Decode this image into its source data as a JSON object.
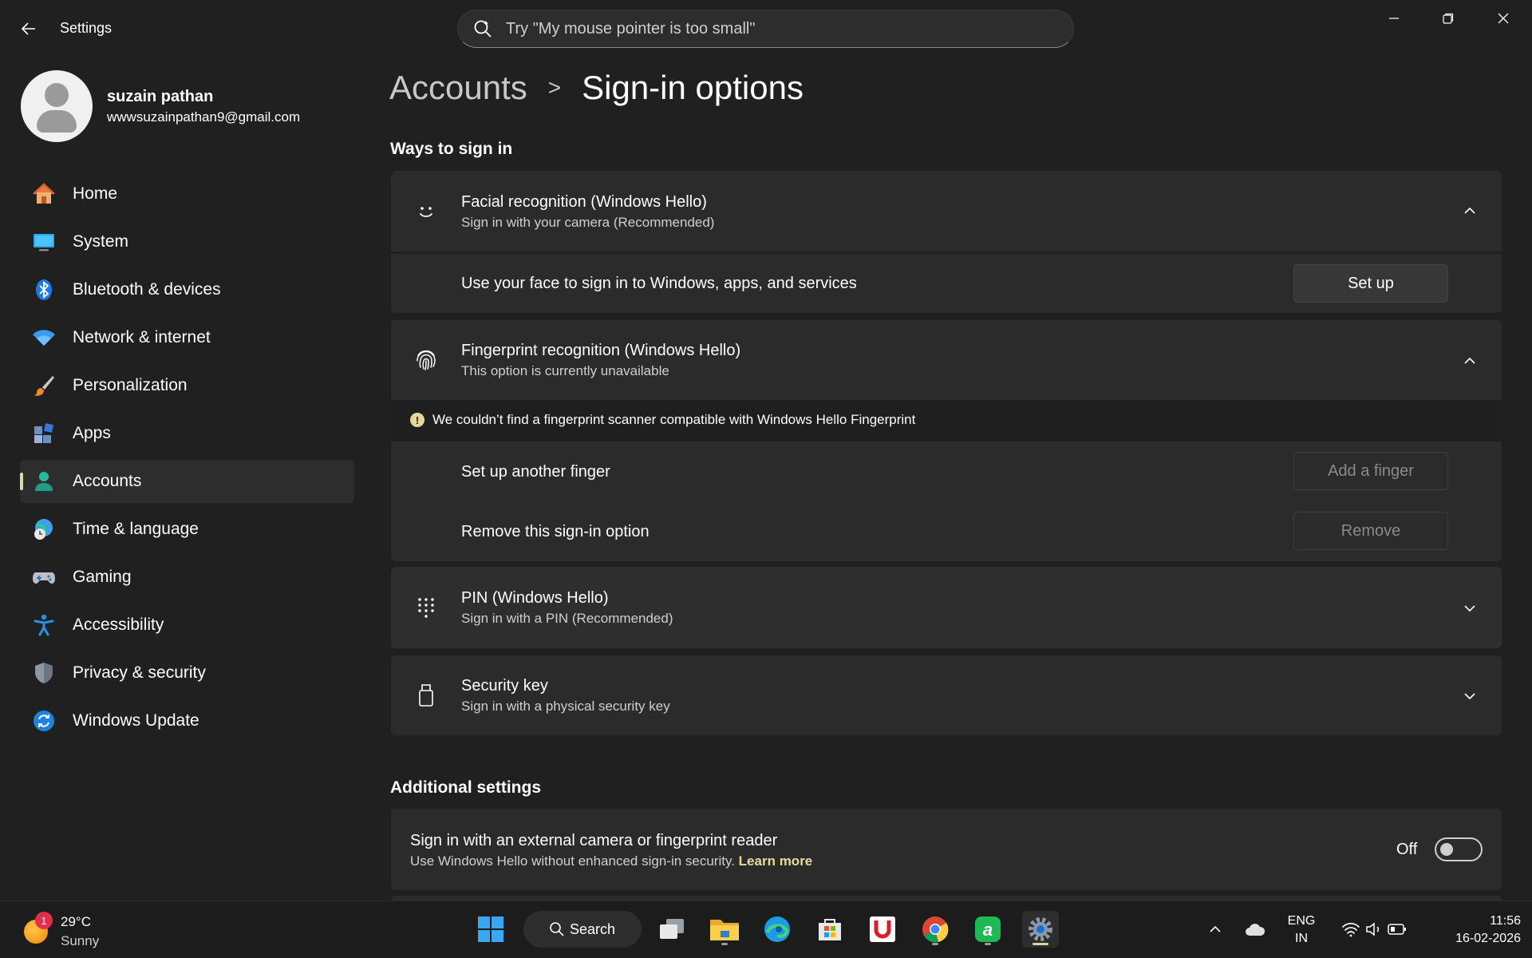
{
  "app": {
    "title": "Settings"
  },
  "search": {
    "placeholder": "Try \"My mouse pointer is too small\""
  },
  "profile": {
    "name": "suzain pathan",
    "email": "wwwsuzainpathan9@gmail.com"
  },
  "nav": [
    {
      "label": "Home",
      "icon": "home-icon",
      "active": false
    },
    {
      "label": "System",
      "icon": "system-icon",
      "active": false
    },
    {
      "label": "Bluetooth & devices",
      "icon": "bluetooth-icon",
      "active": false
    },
    {
      "label": "Network & internet",
      "icon": "wifi-icon",
      "active": false
    },
    {
      "label": "Personalization",
      "icon": "brush-icon",
      "active": false
    },
    {
      "label": "Apps",
      "icon": "apps-icon",
      "active": false
    },
    {
      "label": "Accounts",
      "icon": "accounts-icon",
      "active": true
    },
    {
      "label": "Time & language",
      "icon": "globe-clock-icon",
      "active": false
    },
    {
      "label": "Gaming",
      "icon": "gamepad-icon",
      "active": false
    },
    {
      "label": "Accessibility",
      "icon": "accessibility-icon",
      "active": false
    },
    {
      "label": "Privacy & security",
      "icon": "shield-icon",
      "active": false
    },
    {
      "label": "Windows Update",
      "icon": "update-icon",
      "active": false
    }
  ],
  "breadcrumb": {
    "parent": "Accounts",
    "separator": ">",
    "current": "Sign-in options"
  },
  "ways": {
    "title": "Ways to sign in",
    "facial": {
      "title": "Facial recognition (Windows Hello)",
      "subtitle": "Sign in with your camera (Recommended)",
      "row_label": "Use your face to sign in to Windows, apps, and services",
      "button": "Set up"
    },
    "fingerprint": {
      "title": "Fingerprint recognition (Windows Hello)",
      "subtitle": "This option is currently unavailable",
      "warning": "We couldn’t find a fingerprint scanner compatible with Windows Hello Fingerprint",
      "warning_symbol": "!",
      "row1_label": "Set up another finger",
      "row1_button": "Add a finger",
      "row2_label": "Remove this sign-in option",
      "row2_button": "Remove"
    },
    "pin": {
      "title": "PIN (Windows Hello)",
      "subtitle": "Sign in with a PIN (Recommended)"
    },
    "security_key": {
      "title": "Security key",
      "subtitle": "Sign in with a physical security key"
    }
  },
  "additional": {
    "title": "Additional settings",
    "external": {
      "title": "Sign in with an external camera or fingerprint reader",
      "subtitle": "Use Windows Hello without enhanced sign-in security.",
      "link": "Learn more",
      "toggle_state": "Off"
    }
  },
  "taskbar": {
    "weather_temp": "29°C",
    "weather_cond": "Sunny",
    "weather_badge": "1",
    "search_label": "Search",
    "lang_top": "ENG",
    "lang_bottom": "IN",
    "time": "11:56",
    "date": "16-02-2026"
  },
  "colors": {
    "accent": "#d9d7a6",
    "link": "#e8dc9a",
    "background": "#202020",
    "card": "#2b2b2b"
  }
}
